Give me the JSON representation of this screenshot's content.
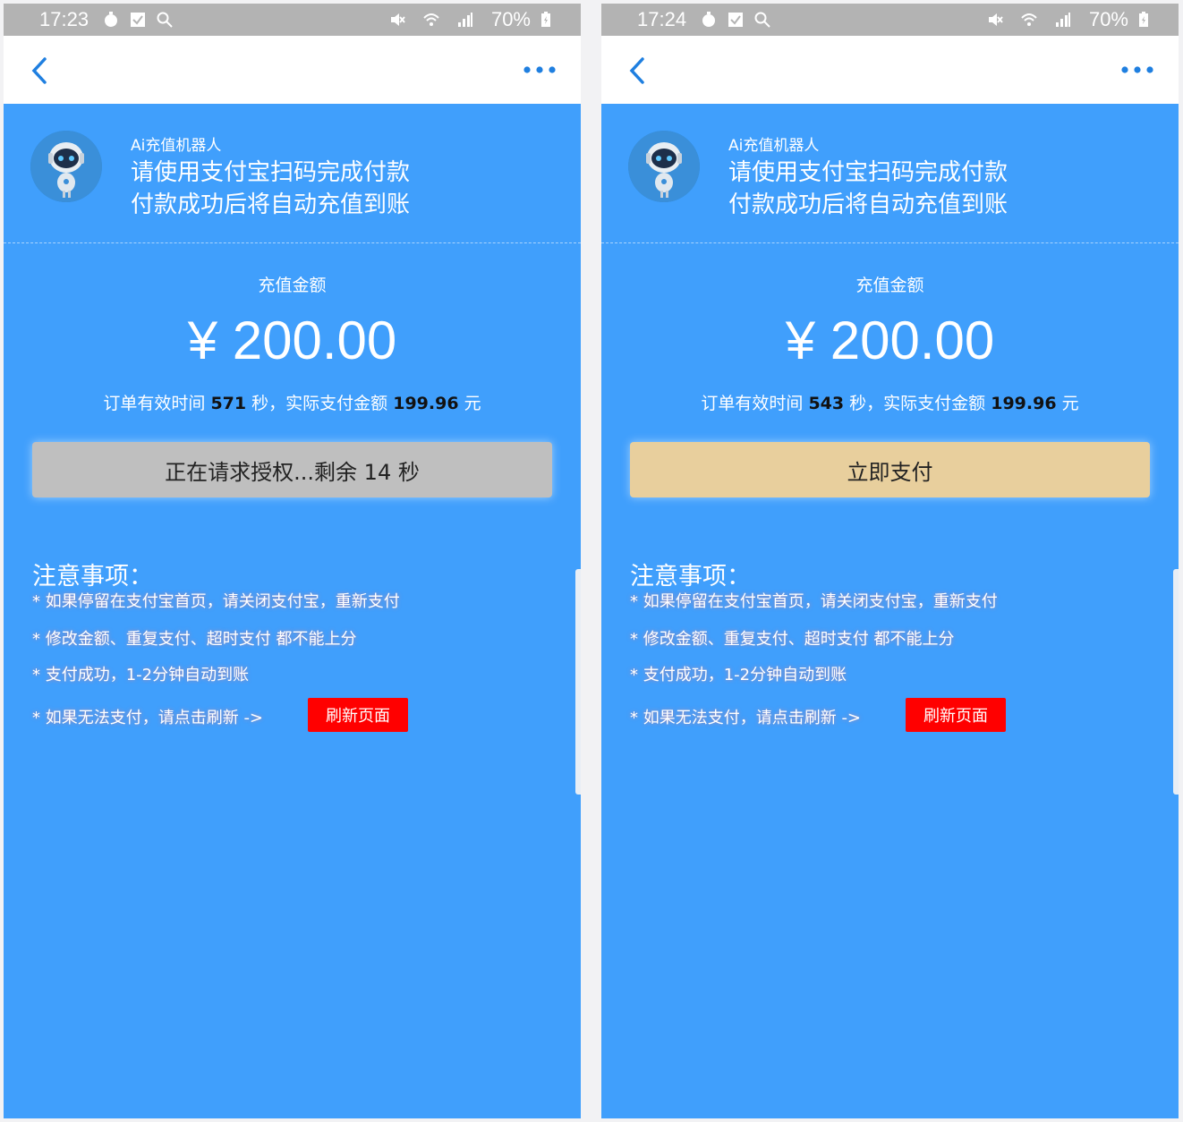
{
  "screens": [
    {
      "status": {
        "time": "17:23",
        "battery": "70%"
      },
      "header": {
        "bot_name": "Ai充值机器人",
        "hint_line1": "请使用支付宝扫码完成付款",
        "hint_line2": "付款成功后将自动充值到账"
      },
      "amount": {
        "label": "充值金额",
        "value": "¥ 200.00"
      },
      "order": {
        "prefix": "订单有效时间 ",
        "seconds": "571",
        "mid": " 秒，实际支付金额 ",
        "pay_amount": "199.96",
        "suffix": " 元"
      },
      "button": {
        "label": "正在请求授权...剩余 14 秒",
        "state": "waiting"
      },
      "notes": {
        "title": "注意事项：",
        "items": [
          "* 如果停留在支付宝首页，请关闭支付宝，重新支付",
          "* 修改金额、重复支付、超时支付 都不能上分",
          "* 支付成功，1-2分钟自动到账",
          "* 如果无法支付，请点击刷新 ->"
        ],
        "refresh_label": "刷新页面"
      }
    },
    {
      "status": {
        "time": "17:24",
        "battery": "70%"
      },
      "header": {
        "bot_name": "Ai充值机器人",
        "hint_line1": "请使用支付宝扫码完成付款",
        "hint_line2": "付款成功后将自动充值到账"
      },
      "amount": {
        "label": "充值金额",
        "value": "¥ 200.00"
      },
      "order": {
        "prefix": "订单有效时间 ",
        "seconds": "543",
        "mid": " 秒，实际支付金额 ",
        "pay_amount": "199.96",
        "suffix": " 元"
      },
      "button": {
        "label": "立即支付",
        "state": "ready"
      },
      "notes": {
        "title": "注意事项：",
        "items": [
          "* 如果停留在支付宝首页，请关闭支付宝，重新支付",
          "* 修改金额、重复支付、超时支付 都不能上分",
          "* 支付成功，1-2分钟自动到账",
          "* 如果无法支付，请点击刷新 ->"
        ],
        "refresh_label": "刷新页面"
      }
    }
  ],
  "colors": {
    "background": "#409ffc",
    "status_bar": "#b3b3b3",
    "waiting_button": "#bfbfbf",
    "pay_button": "#e8cf9d",
    "refresh_button": "#ff0000",
    "nav_icon": "#1f7fe0"
  },
  "icons": [
    "timer-icon",
    "checkbox-icon",
    "search-icon",
    "mute-icon",
    "wifi-icon",
    "signal-icon",
    "battery-icon",
    "back-arrow-icon",
    "more-icon",
    "robot-avatar-icon"
  ]
}
